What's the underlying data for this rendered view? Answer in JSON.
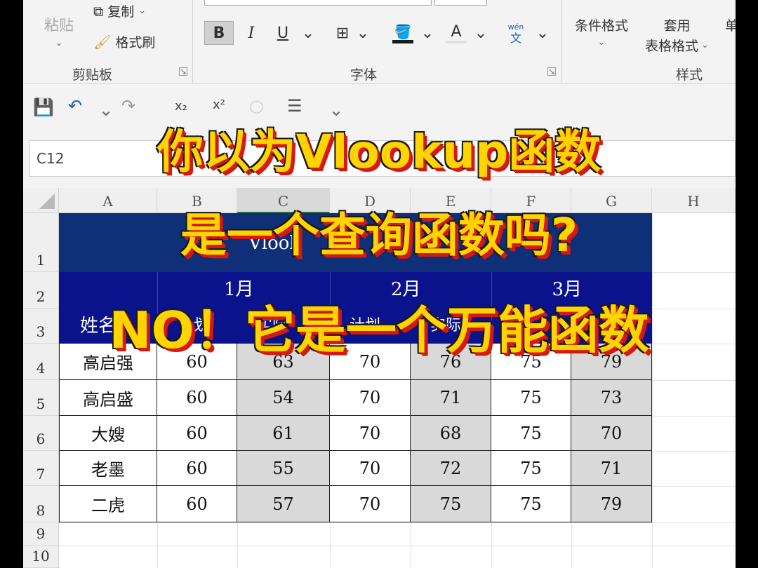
{
  "ribbon": {
    "clipboard": {
      "paste_label": "粘贴",
      "copy_label": "复制",
      "format_painter_label": "格式刷",
      "group_label": "剪贴板"
    },
    "font": {
      "bold": "B",
      "italic": "I",
      "underline": "U",
      "font_color_glyph": "A",
      "phonetic_glyph": "文",
      "phonetic_small": "wén",
      "group_label": "字体"
    },
    "styles": {
      "conditional_format_label": "条件格式",
      "table_format_label_1": "套用",
      "table_format_label_2": "表格格式",
      "cell_styles_partial": "单",
      "group_label": "样式"
    }
  },
  "qat": {
    "subscript": "x₂",
    "superscript": "x²"
  },
  "name_box": "C12",
  "columns": [
    "A",
    "B",
    "C",
    "D",
    "E",
    "F",
    "G",
    "H"
  ],
  "rows": [
    "1",
    "2",
    "3",
    "4",
    "5",
    "6",
    "7",
    "8",
    "9",
    "10"
  ],
  "table": {
    "title_visible": "Vlook",
    "months": [
      "1月",
      "2月",
      "3月"
    ],
    "subheaders_visible": [
      "计划",
      "实际",
      "计划",
      "实际"
    ],
    "name_header_partial": "姓名",
    "data": [
      {
        "name": "高启强",
        "values": [
          "60",
          "63",
          "70",
          "76",
          "75",
          "79"
        ]
      },
      {
        "name": "高启盛",
        "values": [
          "60",
          "54",
          "70",
          "71",
          "75",
          "73"
        ]
      },
      {
        "name": "大嫂",
        "values": [
          "60",
          "61",
          "70",
          "68",
          "75",
          "70"
        ]
      },
      {
        "name": "老墨",
        "values": [
          "60",
          "55",
          "70",
          "72",
          "75",
          "71"
        ]
      },
      {
        "name": "二虎",
        "values": [
          "60",
          "57",
          "70",
          "75",
          "75",
          "79"
        ]
      }
    ]
  },
  "overlay": {
    "line1": "你以为Vlookup函数",
    "line2": "是一个查询函数吗?",
    "line3": "NO！它是一个万能函数"
  }
}
